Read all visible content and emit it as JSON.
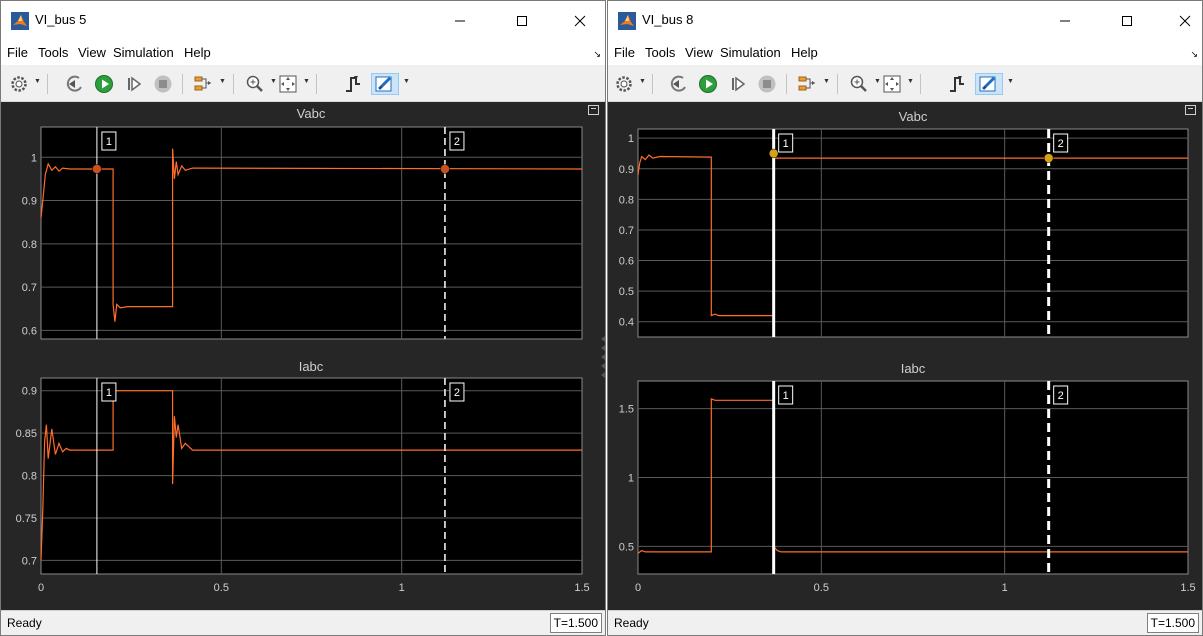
{
  "windows": [
    {
      "title": "VI_bus 5",
      "menu": [
        "File",
        "Tools",
        "View",
        "Simulation",
        "Help"
      ],
      "status": "Ready",
      "time": "T=1.500",
      "plots": [
        {
          "title": "Vabc",
          "xlim": [
            0,
            1.5
          ],
          "ylim": [
            0.58,
            1.07
          ],
          "yticks": [
            "0.6",
            "0.7",
            "0.8",
            "0.9",
            "1"
          ],
          "ytick_values": [
            0.6,
            0.7,
            0.8,
            0.9,
            1.0
          ],
          "xticks": [],
          "cursors": [
            {
              "label": "1",
              "x": 0.155,
              "style": "solid",
              "marker_y": 0.973
            },
            {
              "label": "2",
              "x": 1.12,
              "style": "dashed",
              "marker_y": 0.973
            }
          ],
          "series": [
            [
              0,
              0.86
            ],
            [
              0.005,
              0.9
            ],
            [
              0.012,
              0.96
            ],
            [
              0.02,
              0.985
            ],
            [
              0.03,
              0.97
            ],
            [
              0.04,
              0.978
            ],
            [
              0.05,
              0.968
            ],
            [
              0.06,
              0.975
            ],
            [
              0.08,
              0.973
            ],
            [
              0.2,
              0.973
            ],
            [
              0.2,
              0.66
            ],
            [
              0.205,
              0.62
            ],
            [
              0.21,
              0.66
            ],
            [
              0.22,
              0.652
            ],
            [
              0.24,
              0.655
            ],
            [
              0.365,
              0.655
            ],
            [
              0.365,
              1.02
            ],
            [
              0.37,
              0.95
            ],
            [
              0.375,
              0.99
            ],
            [
              0.38,
              0.96
            ],
            [
              0.39,
              0.98
            ],
            [
              0.4,
              0.97
            ],
            [
              0.42,
              0.975
            ],
            [
              1.5,
              0.973
            ]
          ]
        },
        {
          "title": "Iabc",
          "xlim": [
            0,
            1.5
          ],
          "ylim": [
            0.684,
            0.915
          ],
          "yticks": [
            "0.7",
            "0.75",
            "0.8",
            "0.85",
            "0.9"
          ],
          "ytick_values": [
            0.7,
            0.75,
            0.8,
            0.85,
            0.9
          ],
          "xticks": [
            "0",
            "0.5",
            "1",
            "1.5"
          ],
          "xtick_values": [
            0,
            0.5,
            1.0,
            1.5
          ],
          "cursors": [
            {
              "label": "1",
              "x": 0.155,
              "style": "solid"
            },
            {
              "label": "2",
              "x": 1.12,
              "style": "dashed"
            }
          ],
          "series": [
            [
              0,
              0.7
            ],
            [
              0.005,
              0.76
            ],
            [
              0.01,
              0.84
            ],
            [
              0.015,
              0.86
            ],
            [
              0.02,
              0.82
            ],
            [
              0.03,
              0.855
            ],
            [
              0.04,
              0.825
            ],
            [
              0.05,
              0.838
            ],
            [
              0.06,
              0.828
            ],
            [
              0.07,
              0.832
            ],
            [
              0.08,
              0.83
            ],
            [
              0.2,
              0.83
            ],
            [
              0.2,
              0.9
            ],
            [
              0.365,
              0.9
            ],
            [
              0.365,
              0.79
            ],
            [
              0.37,
              0.87
            ],
            [
              0.375,
              0.845
            ],
            [
              0.38,
              0.86
            ],
            [
              0.39,
              0.832
            ],
            [
              0.4,
              0.838
            ],
            [
              0.42,
              0.83
            ],
            [
              1.5,
              0.83
            ]
          ]
        }
      ]
    },
    {
      "title": "VI_bus 8",
      "menu": [
        "File",
        "Tools",
        "View",
        "Simulation",
        "Help"
      ],
      "status": "Ready",
      "time": "T=1.500",
      "plots": [
        {
          "title": "Vabc",
          "xlim": [
            0,
            1.5
          ],
          "ylim": [
            0.35,
            1.03
          ],
          "yticks": [
            "0.4",
            "0.5",
            "0.6",
            "0.7",
            "0.8",
            "0.9",
            "1"
          ],
          "ytick_values": [
            0.4,
            0.5,
            0.6,
            0.7,
            0.8,
            0.9,
            1.0
          ],
          "xticks": [],
          "cursors": [
            {
              "label": "1",
              "x": 0.37,
              "style": "solid",
              "marker_y": 0.95
            },
            {
              "label": "2",
              "x": 1.12,
              "style": "dashed",
              "marker_y": 0.935
            }
          ],
          "series": [
            [
              0,
              0.88
            ],
            [
              0.005,
              0.92
            ],
            [
              0.01,
              0.94
            ],
            [
              0.02,
              0.93
            ],
            [
              0.03,
              0.945
            ],
            [
              0.04,
              0.935
            ],
            [
              0.06,
              0.94
            ],
            [
              0.2,
              0.938
            ],
            [
              0.2,
              0.42
            ],
            [
              0.21,
              0.425
            ],
            [
              0.22,
              0.42
            ],
            [
              0.37,
              0.42
            ],
            [
              0.37,
              0.935
            ],
            [
              1.5,
              0.935
            ]
          ]
        },
        {
          "title": "Iabc",
          "xlim": [
            0,
            1.5
          ],
          "ylim": [
            0.3,
            1.7
          ],
          "yticks": [
            "0.5",
            "1",
            "1.5"
          ],
          "ytick_values": [
            0.5,
            1.0,
            1.5
          ],
          "xticks": [
            "0",
            "0.5",
            "1",
            "1.5"
          ],
          "xtick_values": [
            0,
            0.5,
            1.0,
            1.5
          ],
          "cursors": [
            {
              "label": "1",
              "x": 0.37,
              "style": "solid"
            },
            {
              "label": "2",
              "x": 1.12,
              "style": "dashed"
            }
          ],
          "series": [
            [
              0,
              0.45
            ],
            [
              0.01,
              0.47
            ],
            [
              0.02,
              0.46
            ],
            [
              0.2,
              0.46
            ],
            [
              0.2,
              1.57
            ],
            [
              0.21,
              1.56
            ],
            [
              0.37,
              1.56
            ],
            [
              0.37,
              0.5
            ],
            [
              0.38,
              0.47
            ],
            [
              0.39,
              0.46
            ],
            [
              1.5,
              0.46
            ]
          ]
        }
      ]
    }
  ],
  "colors": {
    "trace": "#ff6d29",
    "marker1": "#d4a017",
    "marker_left": "#c8501e",
    "cursor": "#ffffff",
    "grid": "#5a5a5a",
    "bg": "#000000"
  },
  "icons": [
    "matlab-logo-icon",
    "minimize-icon",
    "maximize-icon",
    "close-icon",
    "settings-icon",
    "step-back-icon",
    "run-icon",
    "step-forward-icon",
    "stop-icon",
    "signal-select-icon",
    "zoom-in-icon",
    "zoom-fit-icon",
    "triggers-icon",
    "cursor-measurement-icon"
  ]
}
